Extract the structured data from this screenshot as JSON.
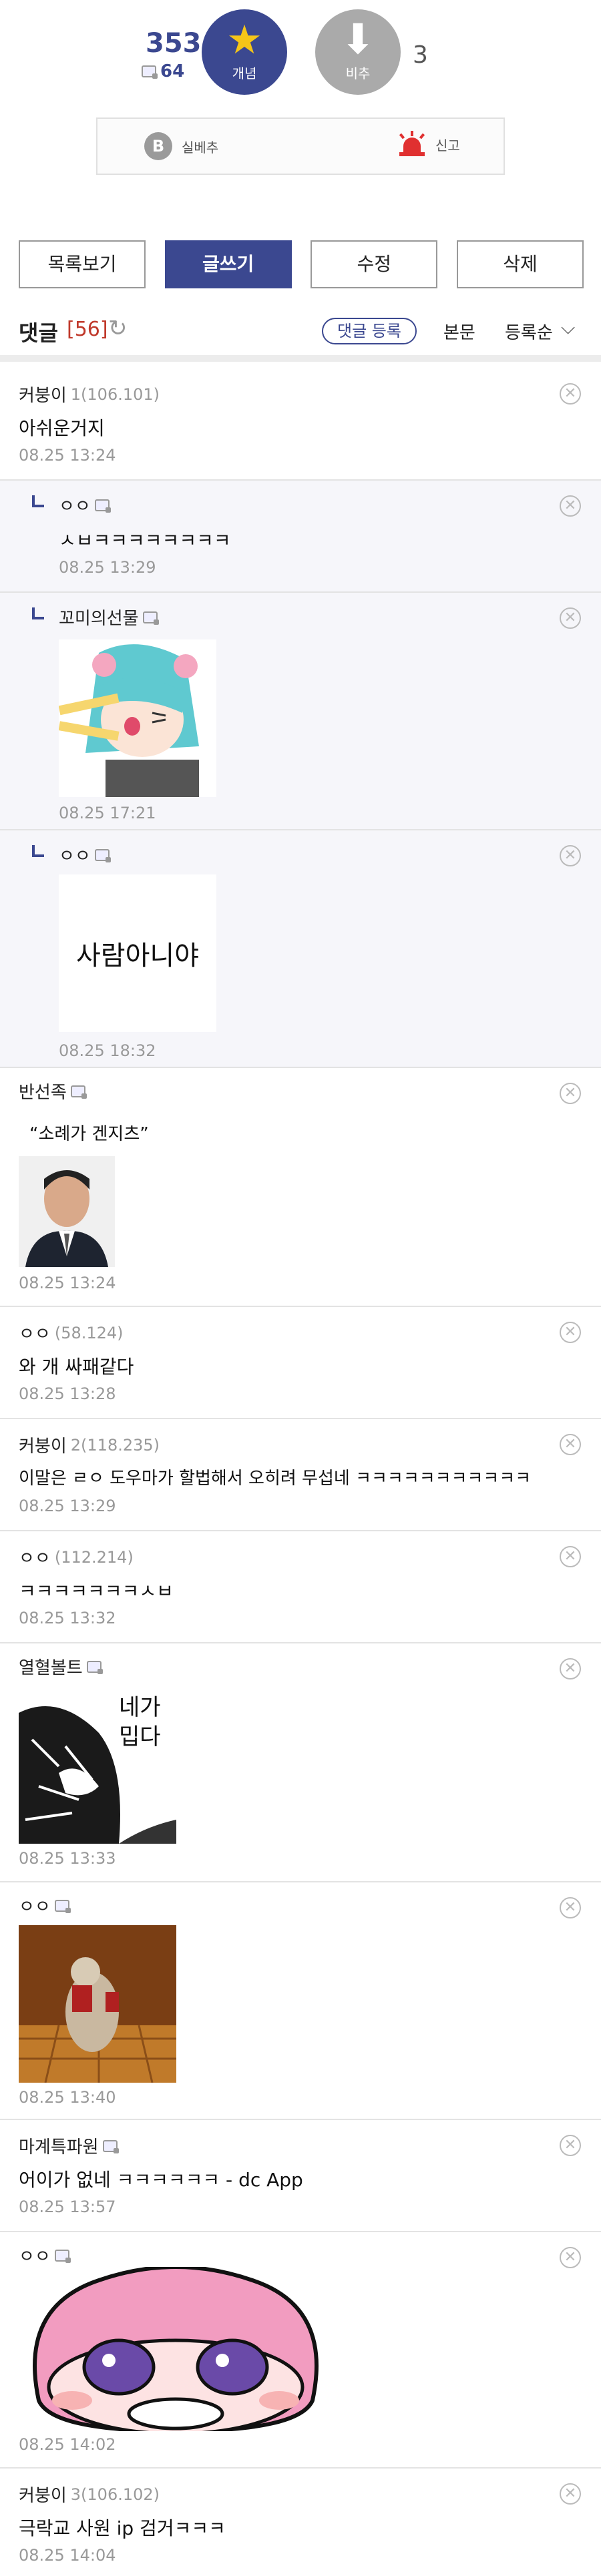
{
  "vote": {
    "up_count": "353",
    "fix_count": "64",
    "up_label": "개념",
    "down_label": "비추",
    "down_count": "3",
    "best_label": "실베추",
    "best_icon": "B",
    "report_label": "신고"
  },
  "buttons": {
    "list": "목록보기",
    "write": "글쓰기",
    "edit": "수정",
    "delete": "삭제"
  },
  "comment_header": {
    "title": "댓글",
    "count": "[56]",
    "register": "댓글 등록",
    "body_link": "본문",
    "sort": "등록순"
  },
  "comments": [
    {
      "author": "커붕이",
      "ip": "1(106.101)",
      "text": "아쉬운거지",
      "time": "08.25 13:24"
    },
    {
      "author": "ㅇㅇ",
      "ip": "",
      "text": "ㅅㅂㅋㅋㅋㅋㅋㅋㅋㅋ",
      "time": "08.25 13:29"
    },
    {
      "author": "꼬미의선물",
      "ip": "",
      "text": "",
      "time": "08.25 17:21"
    },
    {
      "author": "ㅇㅇ",
      "ip": "",
      "image_text": "사람아니야",
      "time": "08.25 18:32"
    },
    {
      "author": "반선족",
      "ip": "",
      "text": "“소례가 겐지츠”",
      "time": "08.25 13:24"
    },
    {
      "author": "ㅇㅇ",
      "ip": "(58.124)",
      "text": "와 개 싸패같다",
      "time": "08.25 13:28"
    },
    {
      "author": "커붕이",
      "ip": "2(118.235)",
      "text": "이말은 ㄹㅇ 도우마가 할법해서 오히려 무섭네 ㅋㅋㅋㅋㅋㅋㅋㅋㅋㅋㅋ",
      "time": "08.25 13:29"
    },
    {
      "author": "ㅇㅇ",
      "ip": "(112.214)",
      "text": "ㅋㅋㅋㅋㅋㅋㅋㅅㅂ",
      "time": "08.25 13:32"
    },
    {
      "author": "열혈볼트",
      "ip": "",
      "image_text": "네가\n밉다",
      "time": "08.25 13:33"
    },
    {
      "author": "ㅇㅇ",
      "ip": "",
      "text": "",
      "time": "08.25 13:40"
    },
    {
      "author": "마계특파원",
      "ip": "",
      "text": "어이가 없네 ㅋㅋㅋㅋㅋㅋ - dc App",
      "time": "08.25 13:57"
    },
    {
      "author": "ㅇㅇ",
      "ip": "",
      "text": "",
      "time": "08.25 14:02"
    },
    {
      "author": "커붕이",
      "ip": "3(106.102)",
      "text": "극락교 사원 ip 검거ㅋㅋㅋ",
      "time": "08.25 14:04"
    }
  ],
  "colors": {
    "accent": "#3b4890",
    "count": "#c0392b",
    "star": "#f5c518",
    "report": "#e03030"
  }
}
